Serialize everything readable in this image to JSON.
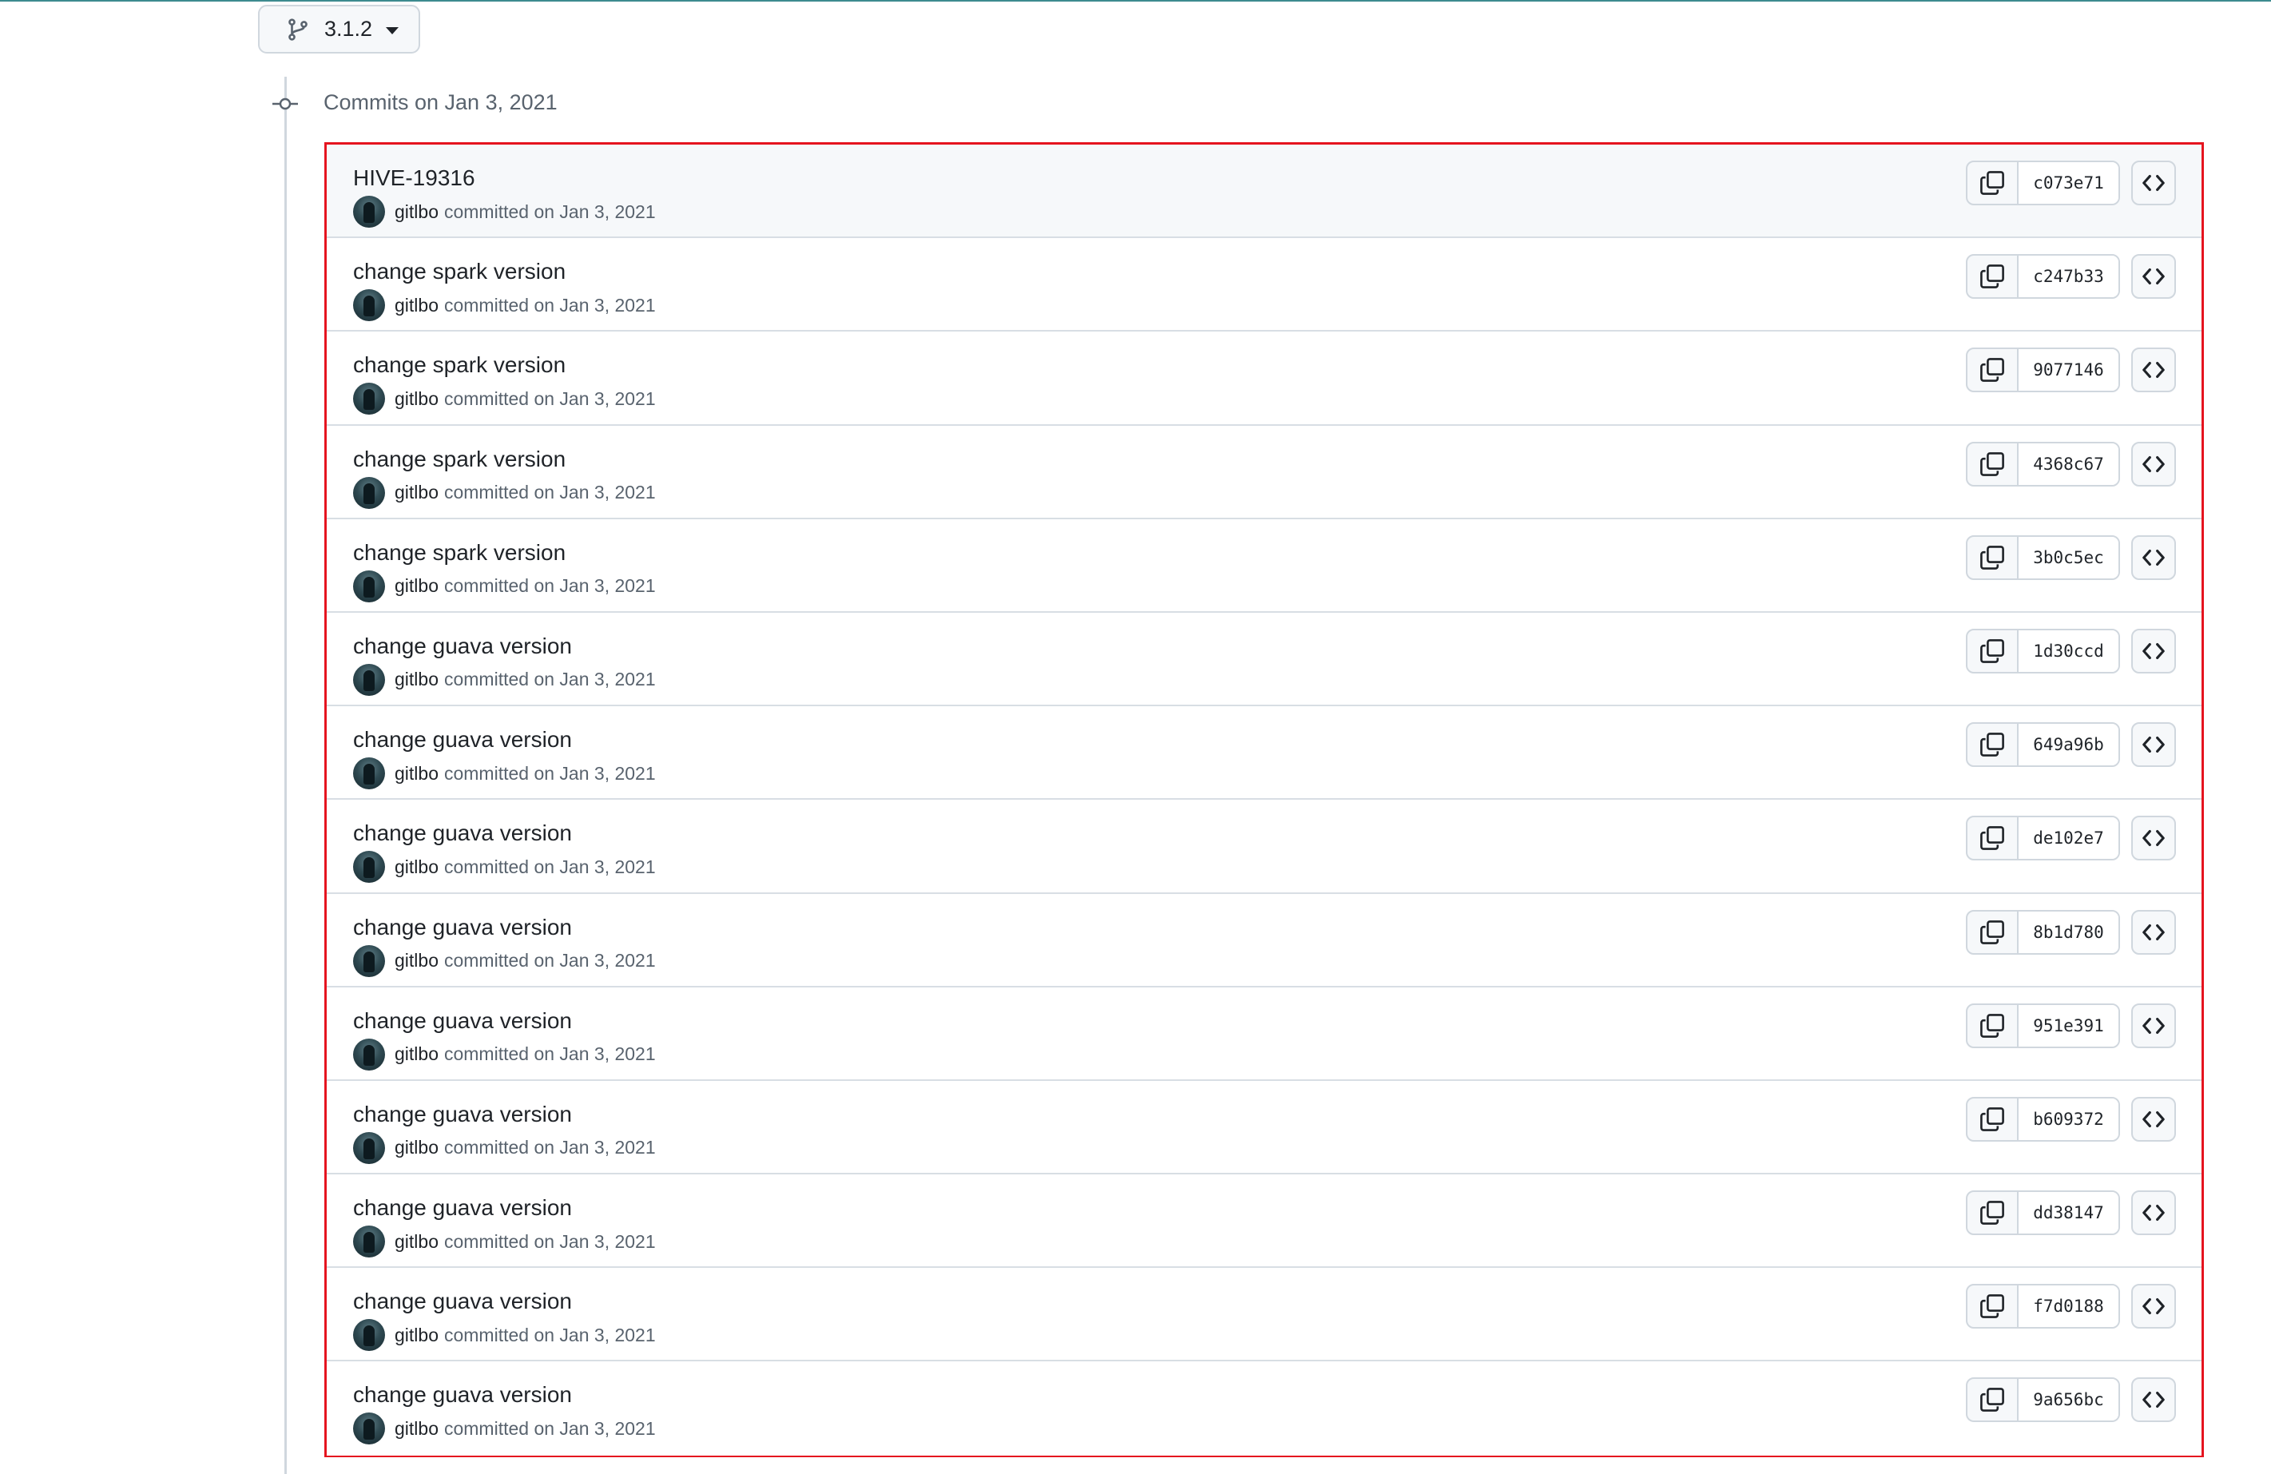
{
  "branch": {
    "name": "3.1.2"
  },
  "timeline": {
    "heading": "Commits on Jan 3, 2021"
  },
  "commits": [
    {
      "title": "HIVE-19316",
      "author": "gitlbo",
      "meta": "committed on Jan 3, 2021",
      "sha": "c073e71"
    },
    {
      "title": "change spark version",
      "author": "gitlbo",
      "meta": "committed on Jan 3, 2021",
      "sha": "c247b33"
    },
    {
      "title": "change spark version",
      "author": "gitlbo",
      "meta": "committed on Jan 3, 2021",
      "sha": "9077146"
    },
    {
      "title": "change spark version",
      "author": "gitlbo",
      "meta": "committed on Jan 3, 2021",
      "sha": "4368c67"
    },
    {
      "title": "change spark version",
      "author": "gitlbo",
      "meta": "committed on Jan 3, 2021",
      "sha": "3b0c5ec"
    },
    {
      "title": "change guava version",
      "author": "gitlbo",
      "meta": "committed on Jan 3, 2021",
      "sha": "1d30ccd"
    },
    {
      "title": "change guava version",
      "author": "gitlbo",
      "meta": "committed on Jan 3, 2021",
      "sha": "649a96b"
    },
    {
      "title": "change guava version",
      "author": "gitlbo",
      "meta": "committed on Jan 3, 2021",
      "sha": "de102e7"
    },
    {
      "title": "change guava version",
      "author": "gitlbo",
      "meta": "committed on Jan 3, 2021",
      "sha": "8b1d780"
    },
    {
      "title": "change guava version",
      "author": "gitlbo",
      "meta": "committed on Jan 3, 2021",
      "sha": "951e391"
    },
    {
      "title": "change guava version",
      "author": "gitlbo",
      "meta": "committed on Jan 3, 2021",
      "sha": "b609372"
    },
    {
      "title": "change guava version",
      "author": "gitlbo",
      "meta": "committed on Jan 3, 2021",
      "sha": "dd38147"
    },
    {
      "title": "change guava version",
      "author": "gitlbo",
      "meta": "committed on Jan 3, 2021",
      "sha": "f7d0188"
    },
    {
      "title": "change guava version",
      "author": "gitlbo",
      "meta": "committed on Jan 3, 2021",
      "sha": "9a656bc"
    }
  ],
  "colors": {
    "highlight_border": "#e5141f",
    "top_rule": "#3d8b8f",
    "muted_text": "#59636e",
    "border": "#d0d7de"
  },
  "icons": {
    "branch": "git-branch-icon",
    "commit_node": "git-commit-icon",
    "copy": "copy-icon",
    "browse": "code-icon"
  }
}
